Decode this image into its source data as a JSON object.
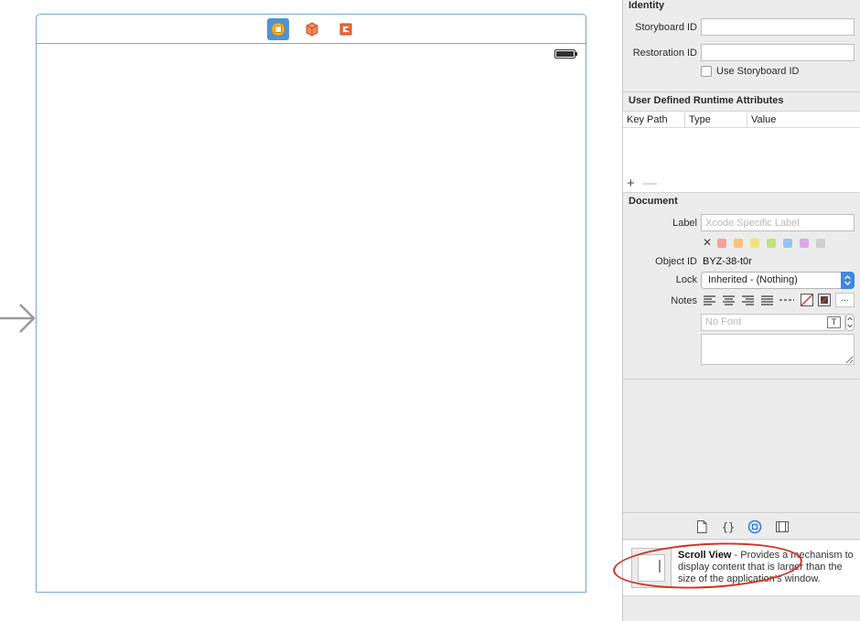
{
  "scene": {
    "dock_icons": [
      "view-controller-icon",
      "first-responder-icon",
      "exit-icon"
    ]
  },
  "inspector": {
    "identity": {
      "heading": "Identity",
      "storyboard_id_label": "Storyboard ID",
      "storyboard_id_value": "",
      "restoration_id_label": "Restoration ID",
      "restoration_id_value": "",
      "use_storyboard_id_label": "Use Storyboard ID",
      "use_storyboard_id_checked": false
    },
    "runtime_attributes": {
      "heading": "User Defined Runtime Attributes",
      "columns": [
        "Key Path",
        "Type",
        "Value"
      ],
      "rows": [],
      "add_label": "+",
      "remove_label": "—"
    },
    "document": {
      "heading": "Document",
      "label_label": "Label",
      "label_placeholder": "Xcode Specific Label",
      "label_colors": [
        "#f3a29a",
        "#f6c27f",
        "#f2e27a",
        "#bfe27d",
        "#96c5f2",
        "#d9a9e6",
        "#cfcfcf"
      ],
      "clear_label": "✕",
      "object_id_label": "Object ID",
      "object_id_value": "BYZ-38-t0r",
      "lock_label": "Lock",
      "lock_value": "Inherited - (Nothing)",
      "notes_label": "Notes",
      "more_label": "...",
      "font_placeholder": "No Font",
      "font_button": "T"
    },
    "library": {
      "tabs": [
        "file-template-icon",
        "code-snippet-icon",
        "object-library-icon",
        "media-library-icon"
      ],
      "selected_tab": "object-library-icon",
      "item_title": "Scroll View",
      "item_description": " - Provides a mechanism to display content that is larger than the size of the application’s window."
    }
  }
}
